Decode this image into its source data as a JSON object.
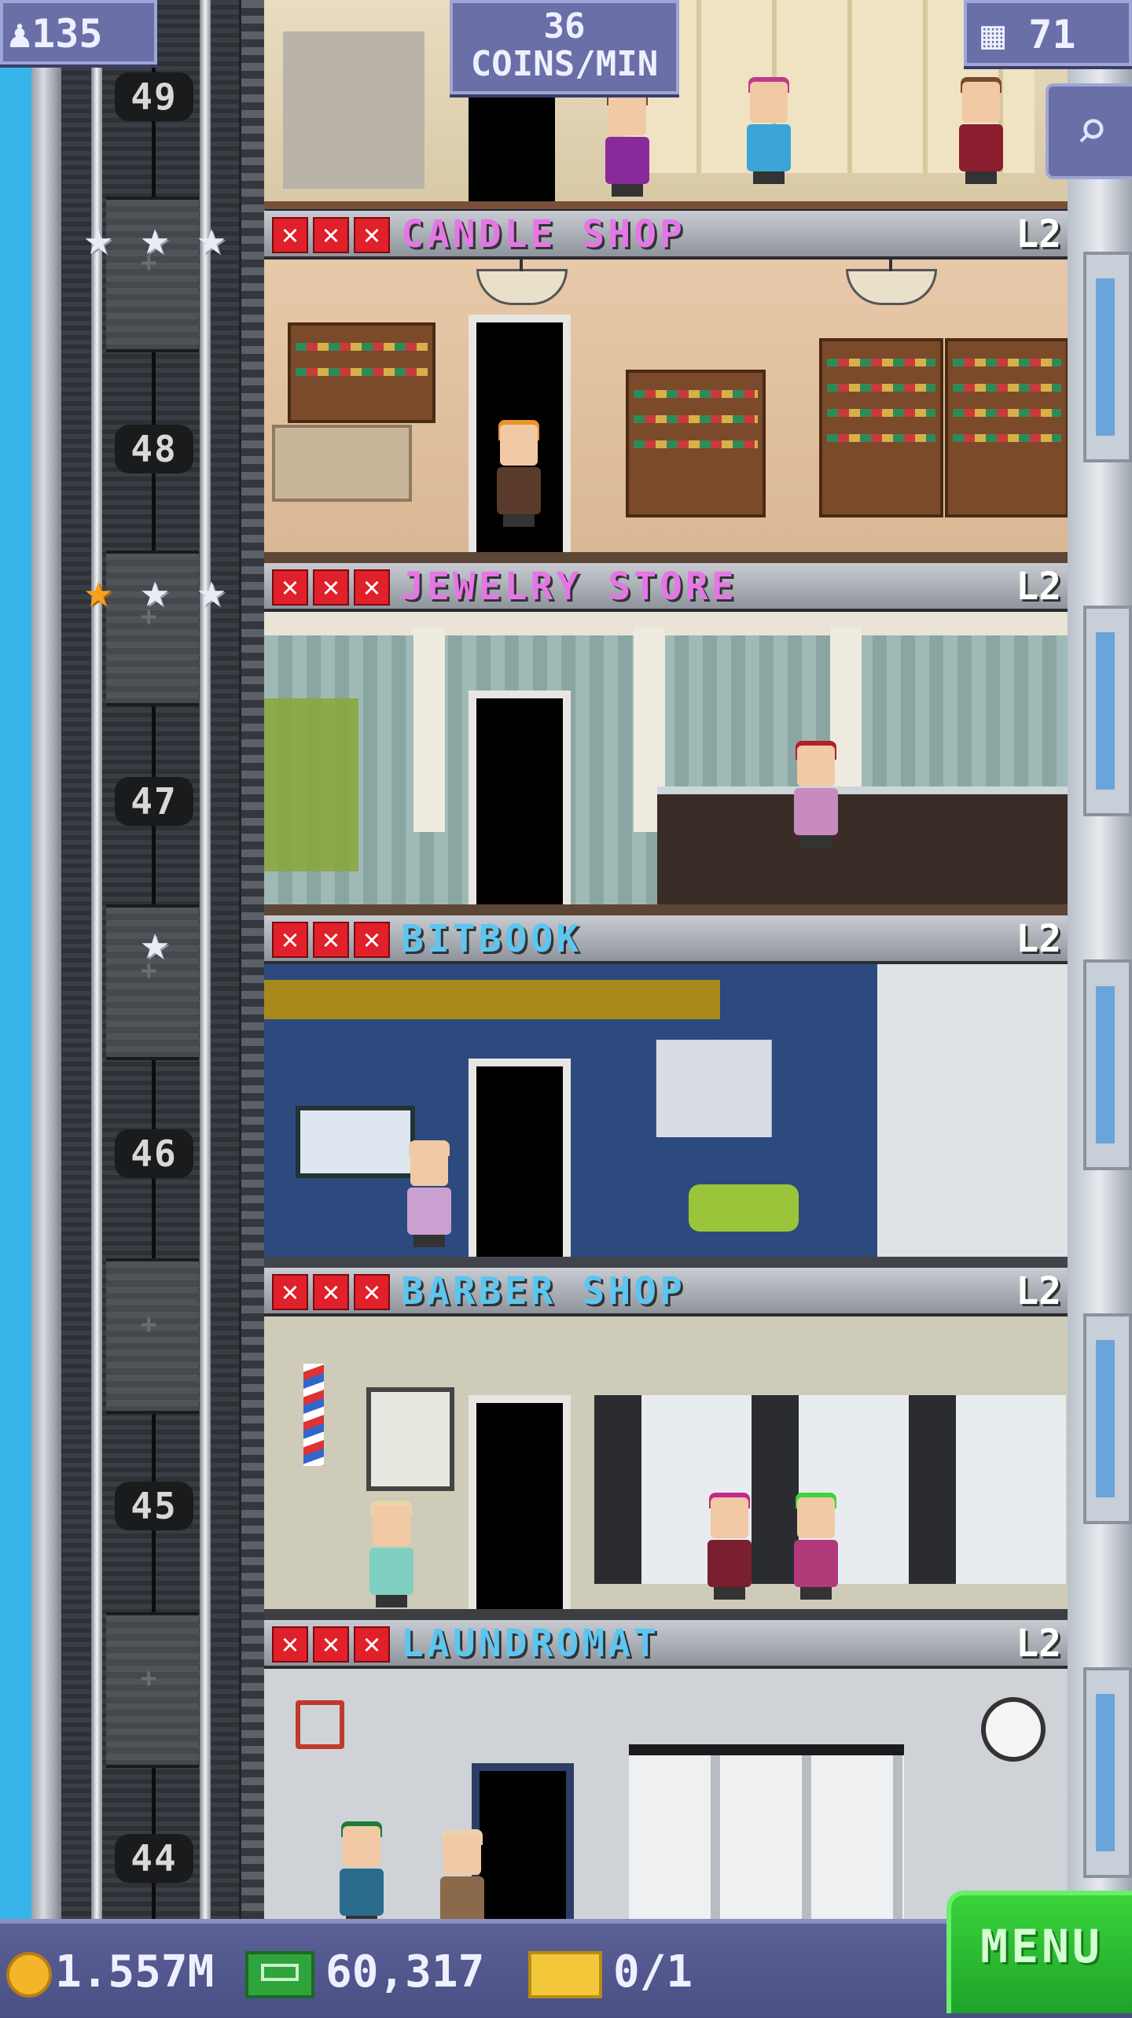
{
  "hud": {
    "population": "135",
    "coins_per_min": "36",
    "coins_per_min_label": "COINS/MIN",
    "floors_count": "71"
  },
  "colors": {
    "header_pink": "#e476e6",
    "header_blue": "#5cc6f0",
    "xmark_red": "#e0202a",
    "menu_green": "#2ebf34",
    "hud_purple": "#6a6fa8"
  },
  "icons": {
    "population": "person-icon",
    "floors": "building-icon",
    "search": "magnifier-icon",
    "coins": "coin-icon",
    "bux": "bux-icon",
    "tickets": "vip-ticket-icon"
  },
  "floors": [
    {
      "number": "49",
      "name": "CANDLE SHOP",
      "level": "L2",
      "stars_filled": 0,
      "stars_total": 3,
      "name_color": "#e476e6"
    },
    {
      "number": "48",
      "name": "JEWELRY STORE",
      "level": "L2",
      "stars_filled": 1,
      "stars_total": 3,
      "name_color": "#e476e6"
    },
    {
      "number": "47",
      "name": "BITBOOK",
      "level": "L2",
      "stars_filled": 0,
      "stars_total": 1,
      "name_color": "#5cc6f0"
    },
    {
      "number": "46",
      "name": "BARBER SHOP",
      "level": "L2",
      "stars_filled": 0,
      "stars_total": 0,
      "name_color": "#5cc6f0"
    },
    {
      "number": "45",
      "name": "LAUNDROMAT",
      "level": "L2",
      "stars_filled": 0,
      "stars_total": 0,
      "name_color": "#5cc6f0"
    },
    {
      "number": "44"
    }
  ],
  "bottom_bar": {
    "coins": "1.557M",
    "bux": "60,317",
    "tickets": "0/1",
    "menu_label": "MENU"
  }
}
